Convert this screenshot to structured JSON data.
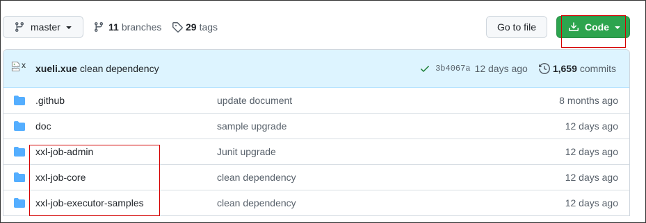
{
  "repo_toolbar": {
    "branch_selector": {
      "icon": "git-branch-icon",
      "label": "master"
    },
    "branches_link": {
      "icon": "git-branch-icon",
      "count": "11",
      "label": "branches"
    },
    "tags_link": {
      "icon": "tag-icon",
      "count": "29",
      "label": "tags"
    },
    "go_to_file_button": {
      "label": "Go to file"
    },
    "code_button": {
      "icon": "download-icon",
      "label": "Code"
    }
  },
  "latest_commit": {
    "avatar_alt": "x",
    "author": "xueli.xue",
    "message": "clean dependency",
    "status_icon": "check-icon",
    "sha": "3b4067a",
    "age": "12 days ago",
    "history_icon": "history-icon",
    "commit_count": "1,659",
    "commit_count_label": "commits"
  },
  "files": [
    {
      "icon": "folder-icon",
      "name": ".github",
      "message": "update document",
      "age": "8 months ago"
    },
    {
      "icon": "folder-icon",
      "name": "doc",
      "message": "sample upgrade",
      "age": "12 days ago"
    },
    {
      "icon": "folder-icon",
      "name": "xxl-job-admin",
      "message": "Junit upgrade",
      "age": "12 days ago"
    },
    {
      "icon": "folder-icon",
      "name": "xxl-job-core",
      "message": "clean dependency",
      "age": "12 days ago"
    },
    {
      "icon": "folder-icon",
      "name": "xxl-job-executor-samples",
      "message": "clean dependency",
      "age": "12 days ago"
    }
  ],
  "colors": {
    "text": "#1f2328",
    "muted": "#57606a",
    "code_button": "#2da44e",
    "commit_header": "#ddf4ff",
    "folder": "#54aeff",
    "check": "#1a7f37",
    "annotation": "#d40000"
  }
}
